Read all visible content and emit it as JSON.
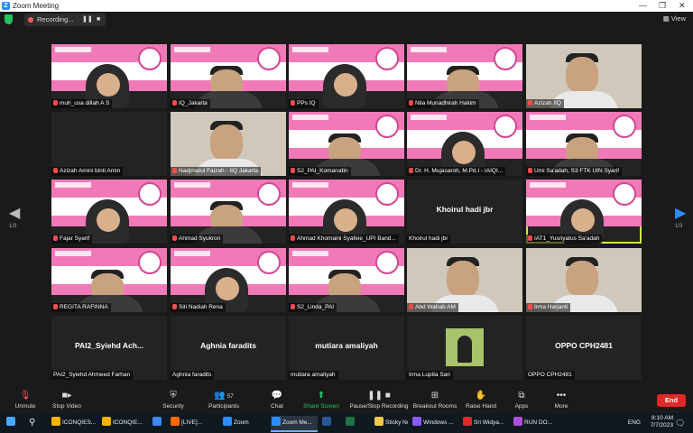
{
  "window": {
    "title": "Zoom Meeting",
    "logo": "Z",
    "controls": [
      "—",
      "❐",
      "✕"
    ]
  },
  "meeting": {
    "recording_label": "Recording...",
    "pause_icon": "❚❚",
    "stop_icon": "■",
    "view_label": "View"
  },
  "tiles": [
    {
      "name": "muh_usa dillah A S",
      "kind": "slide"
    },
    {
      "name": "IQ_Jakarta",
      "kind": "slide"
    },
    {
      "name": "PPs IQ",
      "kind": "slide"
    },
    {
      "name": "Nila Munadhirah Hakim",
      "kind": "slide"
    },
    {
      "name": "Azizah IIQ",
      "kind": "photo"
    },
    {
      "name": "Azizah Amini binti Amin",
      "kind": "black"
    },
    {
      "name": "Nadjmatul Faizah - IIQ Jakarta",
      "kind": "photo"
    },
    {
      "name": "S2_PAI_Komarudin",
      "kind": "slide"
    },
    {
      "name": "Dr. H. Mujasaroh, M.Pd.I - IAIQI...",
      "kind": "slide"
    },
    {
      "name": "Umi Sa'adah, S3 FTK UIN Syarif",
      "kind": "slide"
    },
    {
      "name": "Fajar Syarif",
      "kind": "slide"
    },
    {
      "name": "Ahmad Syukron",
      "kind": "slide"
    },
    {
      "name": "Ahmad Khomaini Syafeie_UPI Band...",
      "kind": "slide"
    },
    {
      "name": "Khoirul hadi jbr",
      "kind": "text",
      "big": "Khoirul hadi jbr"
    },
    {
      "name": "IAT1_Yusriyatus Sa'adah",
      "kind": "slide",
      "active": true
    },
    {
      "name": "REGITA RAFINNA",
      "kind": "slide"
    },
    {
      "name": "Siti Nadiah Rena",
      "kind": "slide"
    },
    {
      "name": "S2_Linda_PAI",
      "kind": "slide"
    },
    {
      "name": "Abd Wahab AM",
      "kind": "photo"
    },
    {
      "name": "Irma Harjanti",
      "kind": "photo"
    },
    {
      "name": "PAI2_Syiehd Ahmeed Farhan",
      "kind": "text",
      "big": "PAI2_Syiehd  Ach..."
    },
    {
      "name": "Aghnia faradits",
      "kind": "text",
      "big": "Aghnia faradits"
    },
    {
      "name": "mutiara amaliyah",
      "kind": "text",
      "big": "mutiara amaliyah"
    },
    {
      "name": "Irma Lupita Sari",
      "kind": "avatar"
    },
    {
      "name": "OPPO CPH2481",
      "kind": "text",
      "big": "OPPO CPH2481"
    }
  ],
  "nav": {
    "left_arrow": "◀",
    "right_arrow": "▶",
    "page_left": "1/3",
    "page_right": "1/3"
  },
  "toolbar": {
    "unmute": "Unmute",
    "stop_video": "Stop Video",
    "security": "Security",
    "participants": "Participants",
    "participants_count": "57",
    "chat": "Chat",
    "share_screen": "Share Screen",
    "pause_recording": "Pause/Stop Recording",
    "breakout_rooms": "Breakout Rooms",
    "raise_hand": "Raise Hand",
    "apps": "Apps",
    "more": "More",
    "end": "End"
  },
  "taskbar": {
    "items": [
      "ICONQIES...",
      "ICONQIE...",
      "[LIVE]...",
      "Zoom",
      "Zoom Me...",
      "Sticky No...",
      "Windows ...",
      "Sri Widya...",
      "RUN DO..."
    ],
    "lang": "ENG",
    "time": "8:10 AM",
    "date": "7/7/2023"
  },
  "colors": {
    "slide_pink": "#f07ab8",
    "active_border": "#cbe94c",
    "share_green": "#23c55e",
    "end_red": "#e02828"
  }
}
